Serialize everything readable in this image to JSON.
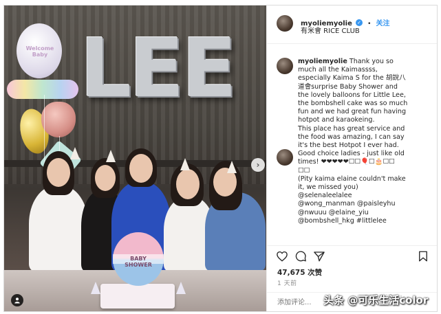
{
  "post": {
    "username": "myoliemyolie",
    "verified_mark": "✓",
    "separator": "•",
    "follow_label": "关注",
    "location": "有米會 RICE CLUB",
    "caption_lines": [
      "Thank you so",
      "much all the Kaimassss,",
      "especially Kaima S for the 胡說八",
      "道會surprise Baby Shower and",
      "the lovely balloons for Little Lee,",
      "the bombshell cake was so much",
      "fun and we had great fun having",
      "hotpot and karaokeing.",
      "This place has great service and",
      "the food was amazing, I can say",
      "it's the best Hotpot I ever had.",
      "Good choice ladies - just like old",
      "times! ❤❤❤❤❤☐☐🎈☐🎂☐☐",
      "☐☐",
      "(Pity kaima elaine couldn't make",
      "it, we missed you)",
      "@selenaleelalee",
      "@wong_manman @paisleyhu",
      "@nwuuu @elaine_yiu",
      "@bombshell_hkg #littlelee"
    ],
    "likes": "47,675 次赞",
    "time_ago": "1 天前",
    "comment_placeholder": "添加评论...",
    "photo_balloon_text": "LEE",
    "photo_small_balloon": "Welcome Baby",
    "photo_cake_text": "BABY SHOWER",
    "nav_arrow": "›"
  },
  "watermark": {
    "main": "头条 @可乐生活color",
    "faint": "可乐生活color"
  },
  "icons": {
    "like": "heart-icon",
    "comment": "comment-icon",
    "share": "share-icon",
    "save": "bookmark-icon",
    "tag": "user-tag-icon"
  },
  "colors": {
    "link": "#3897f0",
    "text": "#262626",
    "muted": "#8e8e8e",
    "border": "#dbdbdb"
  }
}
